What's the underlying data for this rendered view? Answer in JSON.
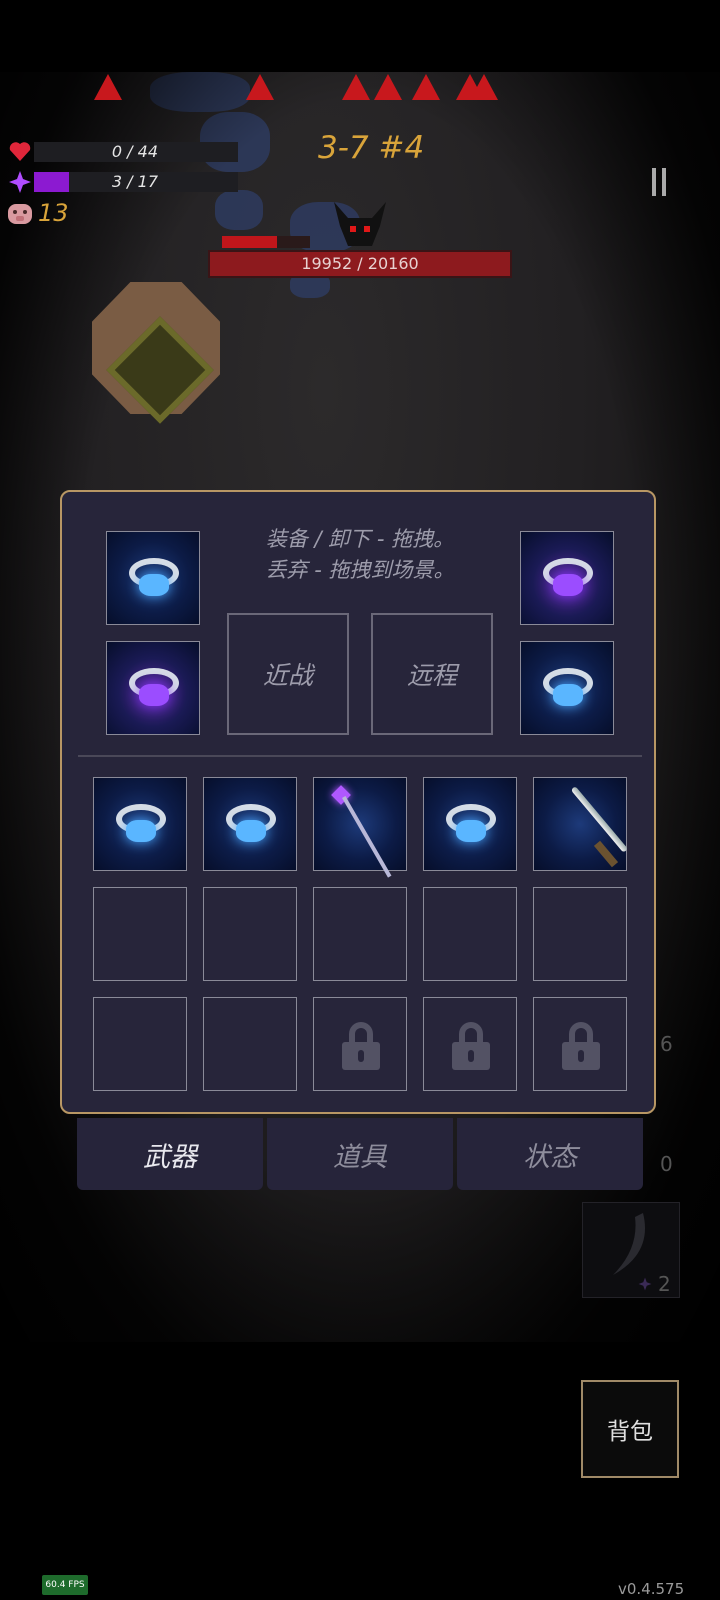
{
  "hud": {
    "health": {
      "current": 0,
      "max": 44,
      "text": "0 / 44"
    },
    "mana": {
      "current": 3,
      "max": 17,
      "text": "3 / 17",
      "fill_fraction": 0.17
    },
    "coins": "13",
    "level_label": "3-7 #4"
  },
  "boss": {
    "hp_text": "19952 / 20160",
    "current": 19952,
    "max": 20160
  },
  "inventory": {
    "hint_line1": "装备 / 卸下 - 拖拽。",
    "hint_line2": "丢弃 - 拖拽到场景。",
    "melee_label": "近战",
    "ranged_label": "远程",
    "equipped": [
      {
        "name": "blue-ring"
      },
      {
        "name": "purple-ring"
      },
      {
        "name": "purple-ring"
      },
      {
        "name": "blue-ring"
      }
    ],
    "grid": [
      "blue-ring",
      "blue-ring",
      "purple-staff",
      "blue-ring",
      "katana",
      "empty",
      "empty",
      "empty",
      "empty",
      "empty",
      "empty",
      "empty",
      "locked",
      "locked",
      "locked"
    ]
  },
  "tabs": [
    {
      "label": "武器",
      "active": true
    },
    {
      "label": "道具",
      "active": false
    },
    {
      "label": "状态",
      "active": false
    }
  ],
  "skill_count": "2",
  "side_numbers": [
    "6",
    "0"
  ],
  "bag_label": "背包",
  "fps": "60.4 FPS",
  "version": "v0.4.575",
  "colors": {
    "health": "#e0263a",
    "mana": "#8c1ad1",
    "level": "#d9a43a",
    "boss_bar": "#8d1a1e",
    "panel_border": "#b89764"
  }
}
